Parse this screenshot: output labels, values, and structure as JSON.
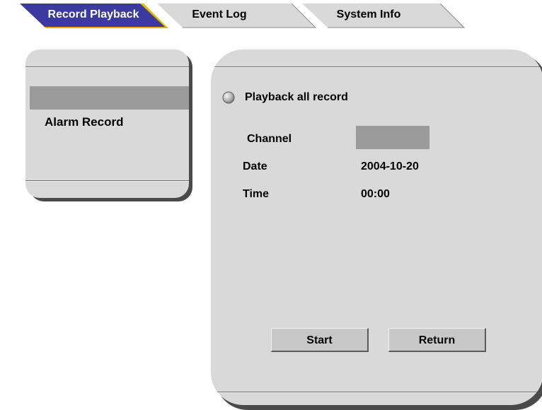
{
  "tabs": [
    {
      "label": "Record Playback",
      "active": true
    },
    {
      "label": "Event Log",
      "active": false
    },
    {
      "label": "System Info",
      "active": false
    }
  ],
  "colors": {
    "active_tab": "#3a3aa0",
    "active_tab_shadow": "#e5b700",
    "inactive_tab": "#d9d9d9",
    "panel": "#d9d9d9",
    "selection": "#9b9b9b",
    "button": "#c8c8c8"
  },
  "record_list": {
    "items": [
      {
        "label": "",
        "selected": true
      },
      {
        "label": "Alarm Record",
        "selected": false
      }
    ]
  },
  "playback": {
    "option_label": "Playback all record",
    "option_icon": "radio-button-icon",
    "channel_label": "Channel",
    "channel_value": "",
    "date_label": "Date",
    "date_value": "2004-10-20",
    "time_label": "Time",
    "time_value": "00:00"
  },
  "buttons": {
    "start": "Start",
    "return": "Return"
  }
}
